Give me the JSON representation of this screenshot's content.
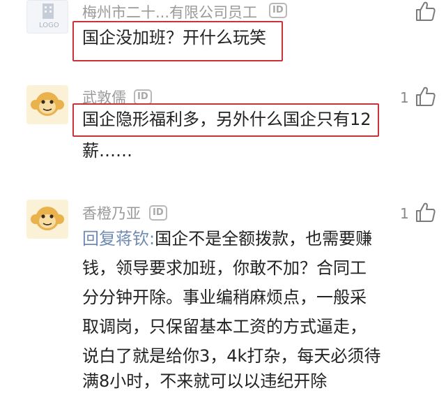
{
  "comments": [
    {
      "author": "梅州市二十...有限公司员工",
      "id_badge": "ID",
      "avatar_text": "LOGO",
      "text": "国企没加班？开什么玩笑",
      "like_count": ""
    },
    {
      "author": "武敦儒",
      "id_badge": "ID",
      "text_line1": "国企隐形福利多，另外什么国企只有12",
      "text_line2": "薪……",
      "like_count": "1"
    },
    {
      "author": "香橙乃亚",
      "id_badge": "ID",
      "reply_prefix": "回复蒋钦:",
      "lines": [
        "国企不是全额拨款，也需要赚",
        "钱，领导要求加班，你敢不加？合同工",
        "分分钟开除。事业编稍麻烦点，一般采",
        "取调岗，只保留基本工资的方式逼走，",
        "说白了就是给你3，4k打杂，每天必须待",
        "满8小时，不来就可以以违纪开除"
      ],
      "like_count": "1"
    }
  ],
  "colors": {
    "highlight": "#c8323a",
    "reply_prefix": "#6f8ab2",
    "author": "#9a9a9a"
  }
}
